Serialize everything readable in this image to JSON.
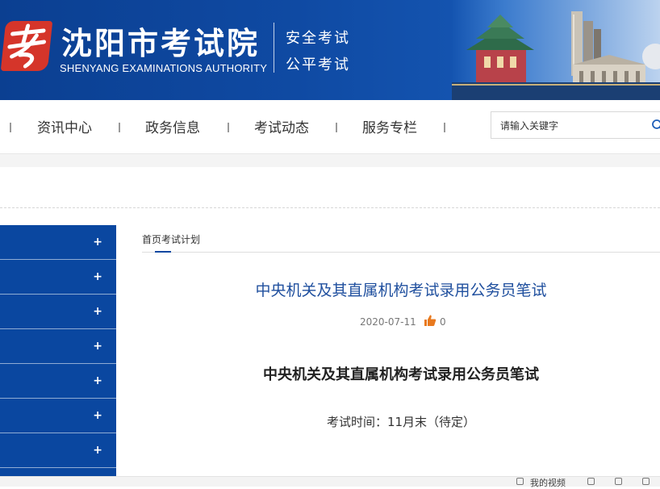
{
  "header": {
    "title_cn": "沈阳市考试院",
    "title_en": "SHENYANG EXAMINATIONS AUTHORITY",
    "slogan_line1": "安全考试",
    "slogan_line2": "公平考试",
    "brand_color": "#0f4aa3",
    "logo_color": "#d5352a"
  },
  "nav": {
    "items": [
      {
        "label": "资讯中心"
      },
      {
        "label": "政务信息"
      },
      {
        "label": "考试动态"
      },
      {
        "label": "服务专栏"
      }
    ],
    "search": {
      "placeholder": "请输入关键字",
      "icon": "search-icon"
    }
  },
  "sidebar": {
    "items": [
      {
        "icon": "plus-icon"
      },
      {
        "icon": "plus-icon"
      },
      {
        "icon": "plus-icon"
      },
      {
        "icon": "plus-icon"
      },
      {
        "icon": "plus-icon"
      },
      {
        "icon": "plus-icon"
      },
      {
        "icon": "plus-icon"
      }
    ],
    "plus_glyph": "+",
    "color": "#0a47a0"
  },
  "breadcrumb": {
    "home": "首页",
    "current": "考试计划"
  },
  "article": {
    "title": "中央机关及其直属机构考试录用公务员笔试",
    "date": "2020-07-11",
    "likes": "0",
    "heading": "中央机关及其直属机构考试录用公务员笔试",
    "line1": "考试时间：11月末（待定）",
    "title_color": "#1f4f9e",
    "like_color": "#e8791e"
  },
  "bottom_bar": {
    "label": "我的视频"
  }
}
